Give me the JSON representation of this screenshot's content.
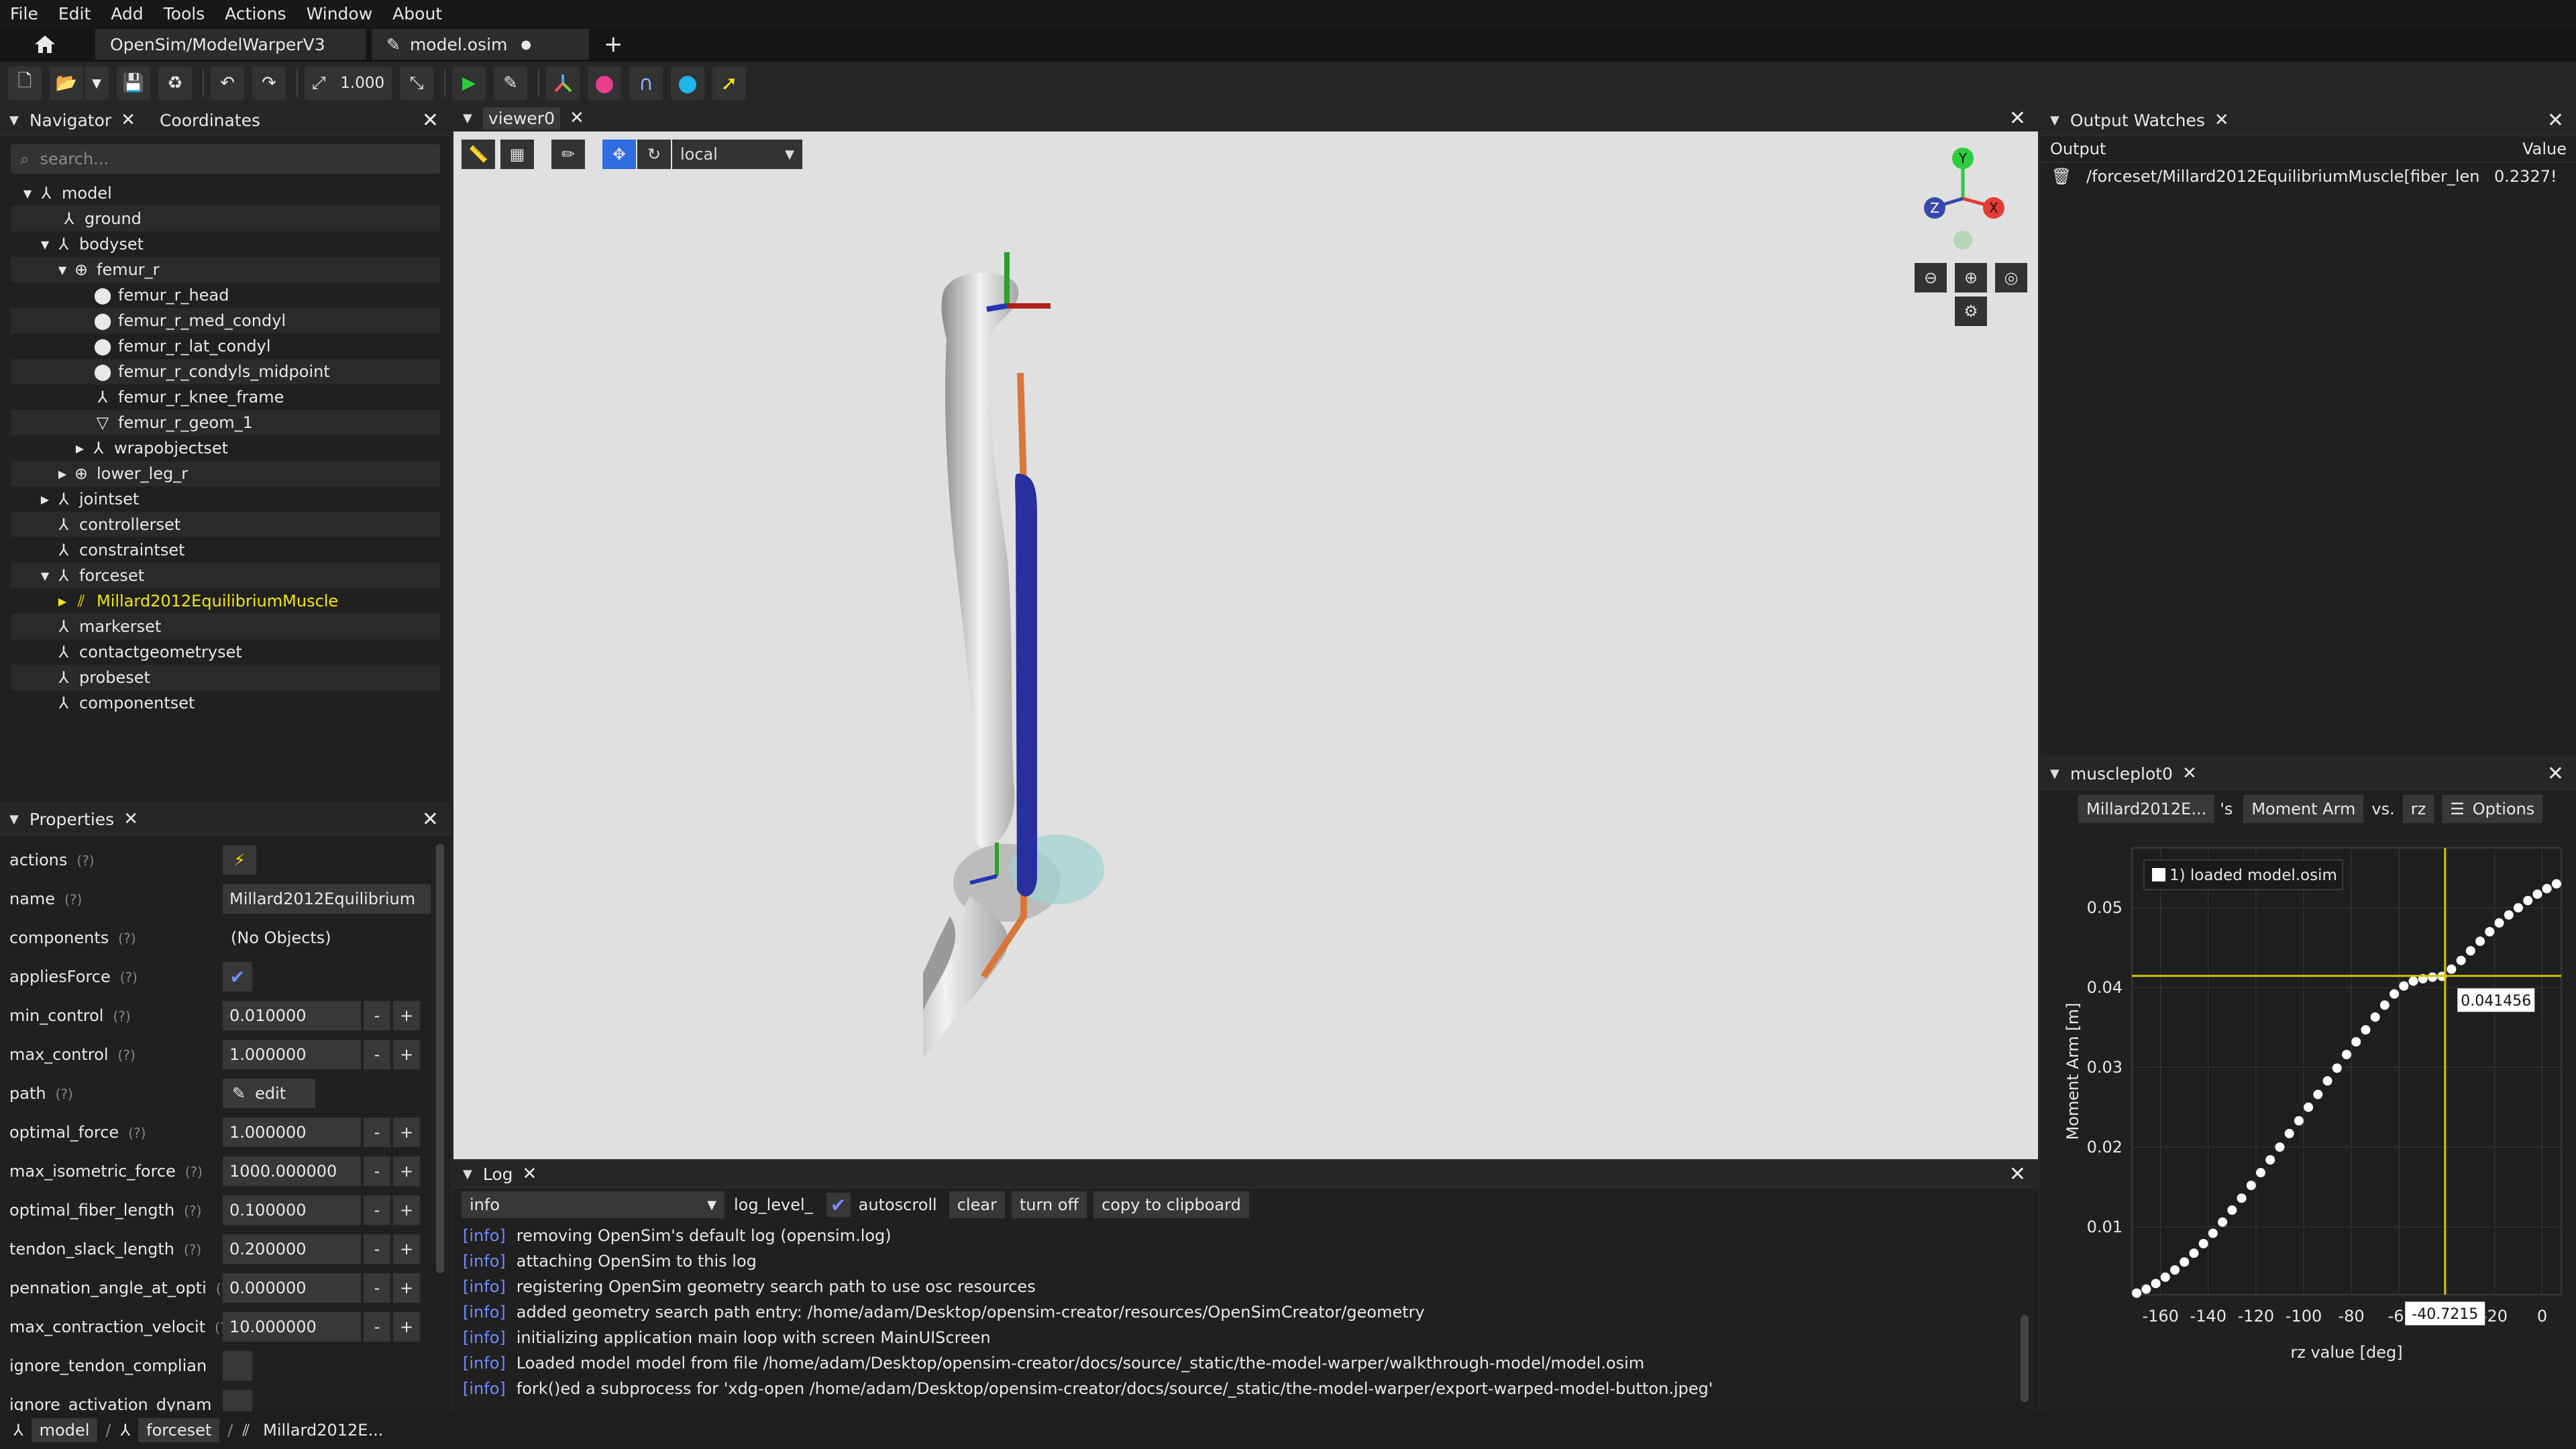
{
  "menu": [
    "File",
    "Edit",
    "Add",
    "Tools",
    "Actions",
    "Window",
    "About"
  ],
  "tabs": [
    {
      "label": "OpenSim/ModelWarperV3"
    },
    {
      "label": "model.osim",
      "modified_marker": "●"
    }
  ],
  "toolbar": {
    "scale_value": "1.000"
  },
  "navigator": {
    "tab1": "Navigator",
    "tab2": "Coordinates",
    "search_placeholder": "search...",
    "tree": [
      "model",
      "ground",
      "bodyset",
      "femur_r",
      "femur_r_head",
      "femur_r_med_condyl",
      "femur_r_lat_condyl",
      "femur_r_condyls_midpoint",
      "femur_r_knee_frame",
      "femur_r_geom_1",
      "wrapobjectset",
      "lower_leg_r",
      "jointset",
      "controllerset",
      "constraintset",
      "forceset",
      "Millard2012EquilibriumMuscle",
      "markerset",
      "contactgeometryset",
      "probeset",
      "componentset"
    ]
  },
  "properties": {
    "title": "Properties",
    "qmark": "(?)",
    "rows": [
      {
        "name": "actions",
        "value": "⚡"
      },
      {
        "name": "name",
        "value": "Millard2012Equilibrium"
      },
      {
        "name": "components",
        "value": "(No Objects)"
      },
      {
        "name": "appliesForce",
        "value": "✔"
      },
      {
        "name": "min_control",
        "value": "0.010000"
      },
      {
        "name": "max_control",
        "value": "1.000000"
      },
      {
        "name": "path",
        "value": "edit"
      },
      {
        "name": "optimal_force",
        "value": "1.000000"
      },
      {
        "name": "max_isometric_force",
        "value": "1000.000000"
      },
      {
        "name": "optimal_fiber_length",
        "value": "0.100000"
      },
      {
        "name": "tendon_slack_length",
        "value": "0.200000"
      },
      {
        "name": "pennation_angle_at_opti",
        "value": "0.000000"
      },
      {
        "name": "max_contraction_velocit",
        "value": "10.000000"
      },
      {
        "name": "ignore_tendon_complian",
        "value": ""
      },
      {
        "name": "ignore_activation_dynam",
        "value": ""
      }
    ],
    "minus": "-",
    "plus": "+"
  },
  "viewer": {
    "tab": "viewer0",
    "frame_mode": "local",
    "axes": {
      "y": "Y",
      "x": "X",
      "z": "Z"
    }
  },
  "log": {
    "title": "Log",
    "level": "info",
    "log_level_label": "log_level_",
    "autoscroll": "autoscroll",
    "clear": "clear",
    "turn_off": "turn off",
    "copy": "copy to clipboard",
    "tag": "[info]",
    "lines": [
      "removing OpenSim's default log (opensim.log)",
      "attaching OpenSim to this log",
      "registering OpenSim geometry search path to use osc resources",
      "added geometry search path entry: /home/adam/Desktop/opensim-creator/resources/OpenSimCreator/geometry",
      "initializing application main loop with screen MainUIScreen",
      "Loaded model model from file /home/adam/Desktop/opensim-creator/docs/source/_static/the-model-warper/walkthrough-model/model.osim",
      "fork()ed a subprocess for 'xdg-open /home/adam/Desktop/opensim-creator/docs/source/_static/the-model-warper/export-warped-model-button.jpeg'"
    ]
  },
  "output_watches": {
    "title": "Output Watches",
    "col_output": "Output",
    "col_value": "Value",
    "row_output": "/forceset/Millard2012EquilibriumMuscle[fiber_len",
    "row_value": "0.2327!"
  },
  "muscleplot": {
    "title": "muscleplot0",
    "muscle": "Millard2012E...",
    "possessive": "'s",
    "output": "Moment Arm",
    "vs": "vs.",
    "coord": "rz",
    "options": "Options",
    "legend": "1) loaded model.osim",
    "hover_y": "0.041456",
    "hover_x": "-40.7215"
  },
  "chart_data": {
    "type": "scatter",
    "xlabel": "rz value [deg]",
    "ylabel": "Moment Arm [m]",
    "xlim": [
      -172,
      8
    ],
    "ylim": [
      0.0015,
      0.0575
    ],
    "xticks": [
      -160,
      -140,
      -120,
      -100,
      -80,
      -60,
      -40,
      -20,
      0
    ],
    "xtick_labels": [
      "-160",
      "-140",
      "-120",
      "-100",
      "-80",
      "-6(",
      "",
      "-20",
      "0"
    ],
    "yticks": [
      0.01,
      0.02,
      0.03,
      0.04,
      0.05
    ],
    "ytick_labels": [
      "0.01",
      "0.02",
      "0.03",
      "0.04",
      "0.05"
    ],
    "grid": true,
    "legend_position": "top-left",
    "cursor": {
      "x": -40.7215,
      "y": 0.041456
    },
    "series": [
      {
        "name": "1) loaded model.osim",
        "x": [
          -170,
          -166,
          -162,
          -158,
          -154,
          -150,
          -146,
          -142,
          -138,
          -134,
          -130,
          -126,
          -122,
          -118,
          -114,
          -110,
          -106,
          -102,
          -98,
          -94,
          -90,
          -86,
          -82,
          -78,
          -74,
          -70,
          -66,
          -62,
          -58,
          -54,
          -50,
          -46,
          -42,
          -38,
          -34,
          -30,
          -26,
          -22,
          -18,
          -14,
          -10,
          -6,
          -2,
          2,
          6
        ],
        "y": [
          0.0017,
          0.0022,
          0.0029,
          0.0037,
          0.0046,
          0.0056,
          0.0067,
          0.0079,
          0.0092,
          0.0106,
          0.0121,
          0.0136,
          0.0152,
          0.0168,
          0.0184,
          0.02,
          0.0217,
          0.0233,
          0.025,
          0.0266,
          0.0283,
          0.0299,
          0.0316,
          0.0332,
          0.0347,
          0.0363,
          0.0378,
          0.0392,
          0.0402,
          0.0408,
          0.0411,
          0.0413,
          0.0414,
          0.0423,
          0.0434,
          0.0446,
          0.0458,
          0.047,
          0.0481,
          0.0491,
          0.05,
          0.0509,
          0.0517,
          0.0524,
          0.053
        ]
      }
    ]
  }
}
